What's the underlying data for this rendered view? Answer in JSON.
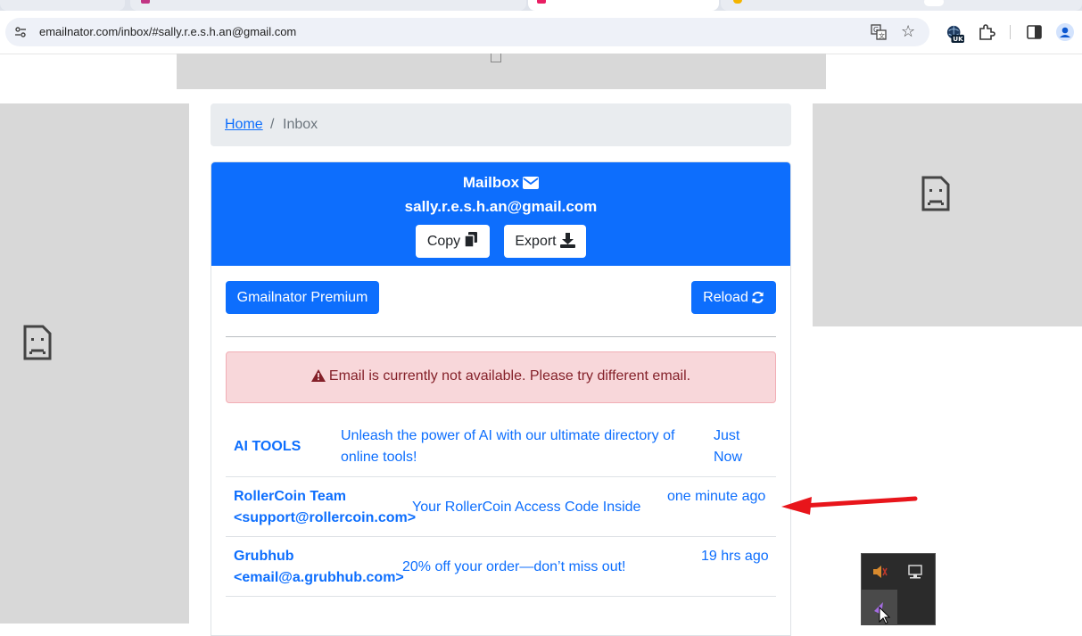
{
  "browser": {
    "url": "emailnator.com/inbox/#sally.r.e.s.h.an@gmail.com",
    "profile_badge": "UK",
    "icons": [
      "site-info-icon",
      "translate-icon",
      "bookmark-star-icon",
      "extension-uk-icon",
      "extensions-puzzle-icon",
      "side-panel-icon",
      "profile-icon"
    ]
  },
  "breadcrumb": {
    "home": "Home",
    "separator": "/",
    "current": "Inbox"
  },
  "mailbox": {
    "title": "Mailbox",
    "address": "sally.r.e.s.h.an@gmail.com",
    "copy_label": "Copy",
    "export_label": "Export",
    "premium_label": "Gmailnator Premium",
    "reload_label": "Reload"
  },
  "alert": {
    "message": "Email is currently not available. Please try different email."
  },
  "messages": [
    {
      "from": "AI TOOLS",
      "subject": "Unleash the power of AI with our ultimate directory of online tools!",
      "time": "Just Now"
    },
    {
      "from": "RollerCoin Team <support@rollercoin.com>",
      "subject": "Your RollerCoin Access Code Inside",
      "time": "one minute ago"
    },
    {
      "from": "Grubhub <email@a.grubhub.com>",
      "subject": "20% off your order—don’t miss out!",
      "time": "19 hrs ago"
    }
  ],
  "colors": {
    "primary": "#0d6efd",
    "alert_bg": "#f8d7da",
    "alert_text": "#842029",
    "annotation_arrow": "#e8151b"
  }
}
